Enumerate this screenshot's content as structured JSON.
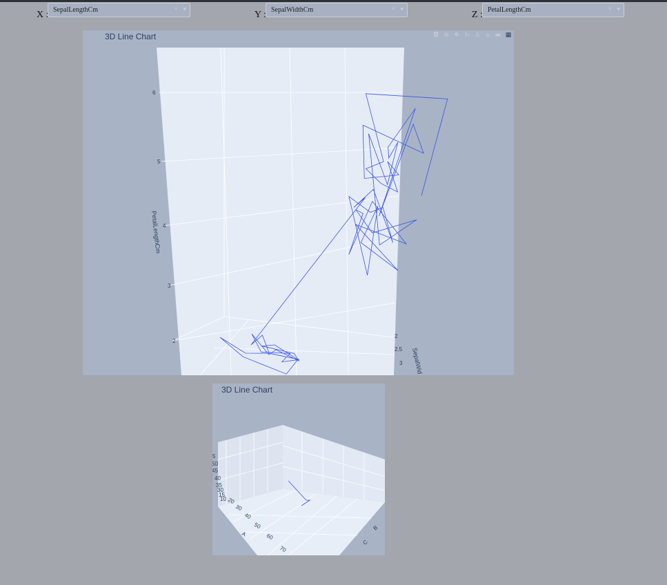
{
  "controls": {
    "x": {
      "label": "X :",
      "value": "SepalLengthCm"
    },
    "y": {
      "label": "Y :",
      "value": "SepalWidthCm"
    },
    "z": {
      "label": "Z :",
      "value": "PetalLengthCm"
    },
    "clear_glyph": "×",
    "arrow_glyph": "▾"
  },
  "modebar": {
    "icons": [
      "camera-icon",
      "zoom-icon",
      "pan-icon",
      "orbit-icon",
      "turntable-icon",
      "reset-camera-icon",
      "hover-icon",
      "plotly-logo-icon"
    ],
    "glyphs": [
      "◘",
      "⊕",
      "✥",
      "↻",
      "⚓",
      "⌂",
      "▬",
      "▦"
    ]
  },
  "colors": {
    "line": "#3b52e6",
    "scene": "#e5ecf6",
    "panel": "#a8b3c5",
    "page": "#a3a6ad"
  },
  "chart_data": [
    {
      "type": "line3d",
      "title": "3D Line Chart",
      "zlabel": "PetalLengthCm",
      "ylabel": "SepalWid",
      "z_ticks": [
        "6",
        "5",
        "4",
        "3",
        "2"
      ],
      "y_ticks": [
        "2",
        "2.5",
        "3"
      ],
      "series": [
        {
          "values": [
            [
              5.1,
              3.5,
              1.4
            ],
            [
              4.9,
              3.0,
              1.4
            ],
            [
              4.7,
              3.2,
              1.3
            ],
            [
              4.6,
              3.1,
              1.5
            ],
            [
              5.0,
              3.6,
              1.4
            ],
            [
              5.4,
              3.9,
              1.7
            ],
            [
              4.6,
              3.4,
              1.4
            ],
            [
              5.0,
              3.4,
              1.5
            ],
            [
              4.4,
              2.9,
              1.4
            ],
            [
              4.9,
              3.1,
              1.5
            ],
            [
              5.4,
              3.7,
              1.5
            ],
            [
              4.8,
              3.4,
              1.6
            ],
            [
              4.8,
              3.0,
              1.4
            ],
            [
              4.3,
              3.0,
              1.1
            ],
            [
              5.8,
              4.0,
              1.2
            ],
            [
              5.7,
              4.4,
              1.5
            ],
            [
              5.4,
              3.9,
              1.3
            ],
            [
              5.1,
              3.5,
              1.4
            ],
            [
              5.7,
              3.8,
              1.7
            ],
            [
              5.1,
              3.8,
              1.5
            ],
            [
              7.0,
              3.2,
              4.7
            ],
            [
              6.4,
              3.2,
              4.5
            ],
            [
              6.9,
              3.1,
              4.9
            ],
            [
              5.5,
              2.3,
              4.0
            ],
            [
              6.5,
              2.8,
              4.6
            ],
            [
              5.7,
              2.8,
              4.5
            ],
            [
              6.3,
              3.3,
              4.7
            ],
            [
              4.9,
              2.4,
              3.3
            ],
            [
              6.6,
              2.9,
              4.6
            ],
            [
              5.2,
              2.7,
              3.9
            ],
            [
              5.0,
              2.0,
              3.5
            ],
            [
              5.9,
              3.0,
              4.2
            ],
            [
              6.0,
              2.2,
              4.0
            ],
            [
              6.1,
              2.9,
              4.7
            ],
            [
              5.6,
              2.9,
              3.6
            ],
            [
              6.7,
              3.1,
              4.4
            ],
            [
              5.6,
              3.0,
              4.5
            ],
            [
              5.8,
              2.7,
              4.1
            ],
            [
              6.2,
              2.2,
              4.5
            ],
            [
              5.6,
              2.5,
              3.9
            ],
            [
              6.3,
              3.3,
              6.0
            ],
            [
              5.8,
              2.7,
              5.1
            ],
            [
              7.1,
              3.0,
              5.9
            ],
            [
              6.3,
              2.9,
              5.6
            ],
            [
              6.5,
              3.0,
              5.8
            ],
            [
              7.6,
              3.0,
              6.6
            ],
            [
              4.9,
              2.5,
              4.5
            ],
            [
              7.3,
              2.9,
              6.3
            ],
            [
              6.7,
              2.5,
              5.8
            ],
            [
              7.2,
              3.6,
              6.1
            ],
            [
              6.5,
              3.2,
              5.1
            ],
            [
              6.4,
              2.7,
              5.3
            ],
            [
              6.8,
              3.0,
              5.5
            ],
            [
              5.7,
              2.5,
              5.0
            ],
            [
              5.8,
              2.8,
              5.1
            ],
            [
              6.4,
              3.2,
              5.3
            ],
            [
              6.5,
              3.0,
              5.5
            ],
            [
              7.7,
              3.8,
              6.7
            ],
            [
              7.7,
              2.6,
              6.9
            ],
            [
              6.0,
              2.2,
              5.0
            ]
          ]
        }
      ]
    },
    {
      "type": "line3d",
      "title": "3D Line Chart",
      "left_ticks": [
        "5",
        "50",
        "45",
        "40",
        "35",
        "30",
        "15",
        "10"
      ],
      "front_ticks": [
        "20",
        "30",
        "40",
        "50",
        "60",
        "70"
      ],
      "front_axis_letter": "A",
      "right_ticks": [
        "B",
        "C"
      ],
      "series": [
        {
          "values": [
            [
              40,
              1,
              60
            ],
            [
              45,
              2,
              48
            ],
            [
              46,
              2.2,
              50
            ],
            [
              44,
              1.6,
              40
            ]
          ]
        }
      ]
    }
  ]
}
